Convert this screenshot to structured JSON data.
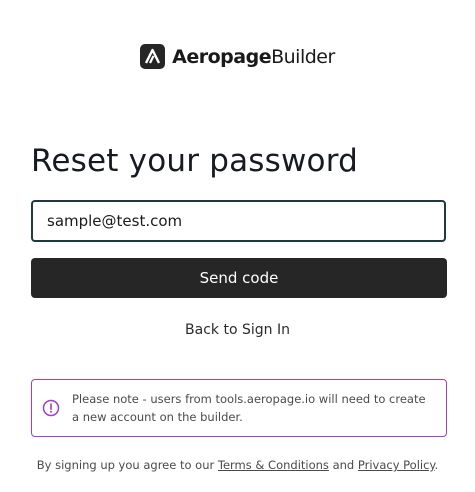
{
  "brand": {
    "name": "Aeropage",
    "suffix": "Builder",
    "logo_icon": "aeropage-logo-icon"
  },
  "page": {
    "title": "Reset your password"
  },
  "form": {
    "email_value": "sample@test.com",
    "send_button_label": "Send code",
    "back_link_label": "Back to Sign In"
  },
  "notice": {
    "icon": "info-circle-icon",
    "text": "Please note - users from tools.aeropage.io will need to create a new account on the builder.",
    "border_color": "#A13EC4"
  },
  "legal": {
    "prefix": "By signing up you agree to our",
    "terms_label": "Terms & Conditions",
    "conjunction": "and",
    "privacy_label": "Privacy Policy",
    "suffix": "."
  },
  "colors": {
    "primary_button": "#262626",
    "input_border": "#1D3A3F",
    "title_text": "#161A22"
  }
}
